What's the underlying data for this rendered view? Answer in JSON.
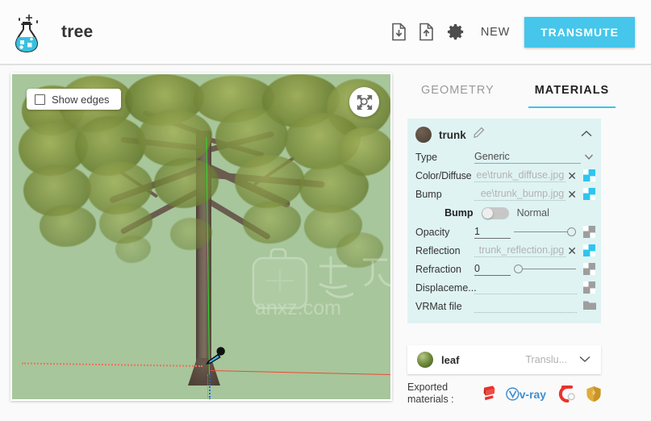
{
  "header": {
    "logo_icon": "flask-sparkle-icon",
    "title": "tree",
    "import_icon": "file-download-icon",
    "export_icon": "file-upload-icon",
    "settings_icon": "gear-icon",
    "new_label": "NEW",
    "transmute_label": "TRANSMUTE",
    "accent_color": "#45c6ea"
  },
  "viewport": {
    "show_edges_label": "Show edges",
    "show_edges_checked": false,
    "zoom_extents_icon": "zoom-extents-icon",
    "cursor_icon": "eyedropper-icon",
    "background_color": "#a7c69b",
    "axis_red_color": "#f04a32",
    "axis_green_color": "#2ee02e",
    "axis_blue_color": "#2b5ee8",
    "watermark_text": "anxz.com"
  },
  "panel": {
    "tabs": [
      {
        "label": "GEOMETRY",
        "active": false
      },
      {
        "label": "MATERIALS",
        "active": true
      }
    ],
    "active_tab_underline_color": "#3fc3e8",
    "material": {
      "name": "trunk",
      "swatch_color": "#594c3f",
      "edit_icon": "pencil-icon",
      "collapse_icon": "chevron-up-icon",
      "rows": {
        "type": {
          "label": "Type",
          "value": "Generic",
          "dropdown_icon": "chevron-down-icon"
        },
        "color_diffuse": {
          "label": "Color/Diffuse",
          "value": "ee\\trunk_diffuse.jpg",
          "clear_icon": "close-icon",
          "texture_icon": "texture-map-icon",
          "texture_active": true
        },
        "bump": {
          "label": "Bump",
          "value": "ee\\trunk_bump.jpg",
          "clear_icon": "close-icon",
          "texture_icon": "texture-map-icon",
          "texture_active": true
        },
        "bump_normal_toggle": {
          "left_label": "Bump",
          "right_label": "Normal",
          "state": "Bump"
        },
        "opacity": {
          "label": "Opacity",
          "value": "1",
          "slider_percent": 100,
          "texture_icon": "texture-map-icon",
          "texture_active": false
        },
        "reflection": {
          "label": "Reflection",
          "value": "trunk_reflection.jpg",
          "clear_icon": "close-icon",
          "texture_icon": "texture-map-icon",
          "texture_active": true
        },
        "refraction": {
          "label": "Refraction",
          "value": "0",
          "slider_percent": 0,
          "texture_icon": "texture-map-icon",
          "texture_active": false
        },
        "displacement": {
          "label": "Displaceme...",
          "value": "",
          "texture_icon": "texture-map-icon",
          "texture_active": false
        },
        "vrmat": {
          "label": "VRMat file",
          "value": "",
          "folder_icon": "folder-icon"
        }
      }
    },
    "material_collapsed": {
      "name": "leaf",
      "type": "Translu...",
      "swatch_color": "#6f8a3a",
      "expand_icon": "chevron-down-icon"
    },
    "exported": {
      "label_line1": "Exported",
      "label_line2": "materials :",
      "icons": [
        {
          "name": "sketchup-icon",
          "color": "#e8322c"
        },
        {
          "name": "vray-icon",
          "color": "#3d8fd1"
        },
        {
          "name": "corona-icon",
          "color": "#e8332c"
        },
        {
          "name": "shield-icon",
          "color": "#e0ab3c"
        }
      ]
    }
  }
}
